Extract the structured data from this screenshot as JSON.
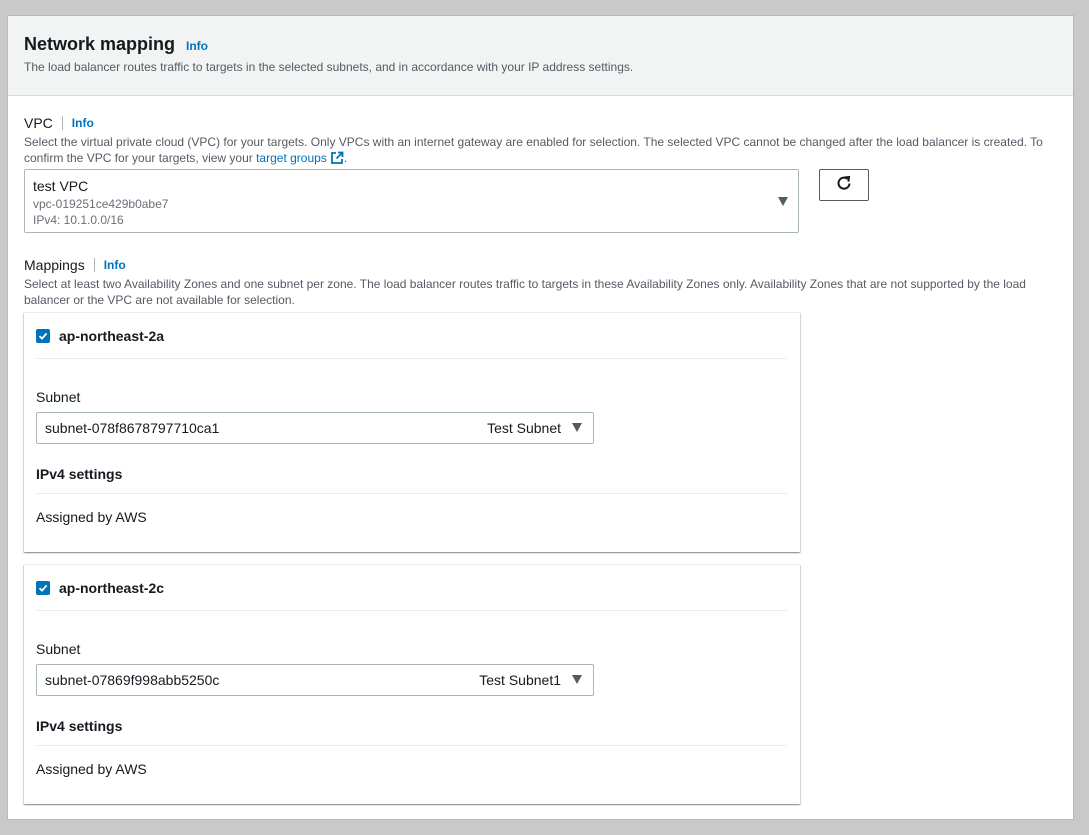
{
  "section": {
    "title": "Network mapping",
    "info": "Info",
    "description": "The load balancer routes traffic to targets in the selected subnets, and in accordance with your IP address settings."
  },
  "vpc": {
    "label": "VPC",
    "info": "Info",
    "description_before": "Select the virtual private cloud (VPC) for your targets. Only VPCs with an internet gateway are enabled for selection. The selected VPC cannot be changed after the load balancer is created. To confirm the VPC for your targets, view your ",
    "description_link": "target groups",
    "description_after": ".",
    "selected": {
      "name": "test VPC",
      "id": "vpc-019251ce429b0abe7",
      "cidr": "IPv4: 10.1.0.0/16"
    },
    "refresh_icon": "refresh-icon"
  },
  "mappings": {
    "label": "Mappings",
    "info": "Info",
    "description": "Select at least two Availability Zones and one subnet per zone. The load balancer routes traffic to targets in these Availability Zones only. Availability Zones that are not supported by the load balancer or the VPC are not available for selection.",
    "zones": [
      {
        "name": "ap-northeast-2a",
        "checked": true,
        "subnet_label": "Subnet",
        "subnet_id": "subnet-078f8678797710ca1",
        "subnet_name": "Test Subnet",
        "ipv4_heading": "IPv4 settings",
        "ipv4_value": "Assigned by AWS"
      },
      {
        "name": "ap-northeast-2c",
        "checked": true,
        "subnet_label": "Subnet",
        "subnet_id": "subnet-07869f998abb5250c",
        "subnet_name": "Test Subnet1",
        "ipv4_heading": "IPv4 settings",
        "ipv4_value": "Assigned by AWS"
      }
    ]
  },
  "colors": {
    "link": "#0073bb",
    "checkbox": "#0073bb",
    "header_bg": "#f2f3f3"
  }
}
